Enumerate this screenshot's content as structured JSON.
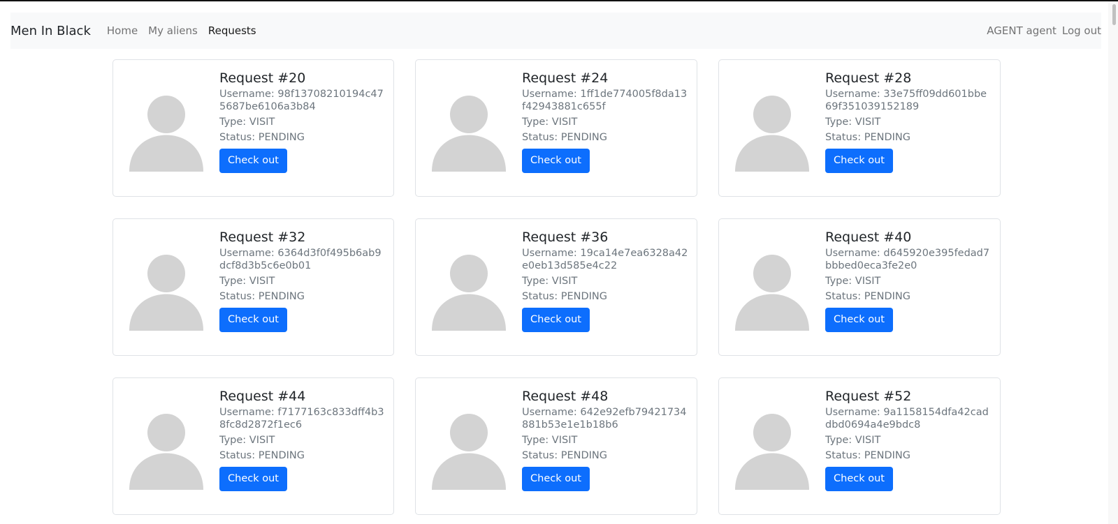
{
  "navbar": {
    "brand": "Men In Black",
    "links": [
      "Home",
      "My aliens",
      "Requests"
    ],
    "user": "AGENT agent",
    "logout": "Log out"
  },
  "requests": [
    {
      "title": "Request #20",
      "username": "Username: 98f13708210194c475687be6106a3b84",
      "type": "Type: VISIT",
      "status": "Status: PENDING",
      "button": "Check out"
    },
    {
      "title": "Request #24",
      "username": "Username: 1ff1de774005f8da13f42943881c655f",
      "type": "Type: VISIT",
      "status": "Status: PENDING",
      "button": "Check out"
    },
    {
      "title": "Request #28",
      "username": "Username: 33e75ff09dd601bbe69f351039152189",
      "type": "Type: VISIT",
      "status": "Status: PENDING",
      "button": "Check out"
    },
    {
      "title": "Request #32",
      "username": "Username: 6364d3f0f495b6ab9dcf8d3b5c6e0b01",
      "type": "Type: VISIT",
      "status": "Status: PENDING",
      "button": "Check out"
    },
    {
      "title": "Request #36",
      "username": "Username: 19ca14e7ea6328a42e0eb13d585e4c22",
      "type": "Type: VISIT",
      "status": "Status: PENDING",
      "button": "Check out"
    },
    {
      "title": "Request #40",
      "username": "Username: d645920e395fedad7bbbed0eca3fe2e0",
      "type": "Type: VISIT",
      "status": "Status: PENDING",
      "button": "Check out"
    },
    {
      "title": "Request #44",
      "username": "Username: f7177163c833dff4b38fc8d2872f1ec6",
      "type": "Type: VISIT",
      "status": "Status: PENDING",
      "button": "Check out"
    },
    {
      "title": "Request #48",
      "username": "Username: 642e92efb79421734881b53e1e1b18b6",
      "type": "Type: VISIT",
      "status": "Status: PENDING",
      "button": "Check out"
    },
    {
      "title": "Request #52",
      "username": "Username: 9a1158154dfa42caddbd0694a4e9bdc8",
      "type": "Type: VISIT",
      "status": "Status: PENDING",
      "button": "Check out"
    }
  ],
  "colors": {
    "primary": "#0d6efd",
    "navbar_bg": "#f8f9fa",
    "muted_text": "#6c757d",
    "avatar_gray": "#d3d3d3"
  }
}
